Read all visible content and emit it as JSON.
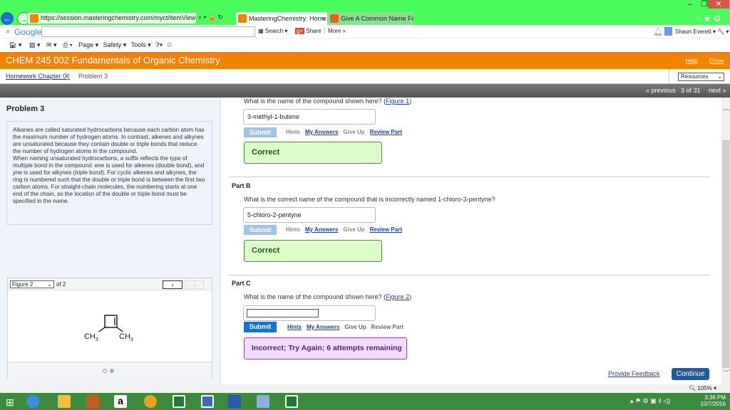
{
  "browser": {
    "url": "https://session.masteringchemistry.com/myct/itemView?assignn",
    "tabs": [
      {
        "label": "MasteringChemistry: Home...",
        "active": true
      },
      {
        "label": "Give A Common Name For Th...",
        "active": false
      }
    ],
    "google_toolbar": {
      "brand": "Google",
      "search_label": "Search",
      "share_label": "Share",
      "more_label": "More »",
      "user": "Shaun Everett"
    },
    "command_bar": {
      "page": "Page",
      "safety": "Safety",
      "tools": "Tools"
    },
    "zoom": "105%"
  },
  "header": {
    "title": "CHEM 245 002 Fundamentals of Organic Chemistry",
    "help": "Help",
    "close": "Close"
  },
  "breadcrumb": {
    "parent": "Homework Chapter 06",
    "current": "Problem 3",
    "resources": "Resources"
  },
  "pager": {
    "previous": "« previous",
    "position": "3 of 31",
    "next": "next »"
  },
  "problem": {
    "title": "Problem 3",
    "intro_p1": "Alkanes are called saturated hydrocarbons because each carbon atom has the maximum number of hydrogen atoms. In contrast, alkenes and alkynes are unsaturated because they contain double or triple bonds that reduce the number of hydrogen atoms in the compound.",
    "intro_p2a": "When naming unsaturated hydrocarbons, a suffix reflects the type of multiple bond in the compound: ",
    "ene": "ene",
    "intro_p2b": " is used for alkenes (double bond), and ",
    "yne": "yne",
    "intro_p2c": " is used for alkynes (triple bond). For cyclic alkenes and alkynes, the ring is numbered such that the double or triple bond is between the first two carbon atoms. For straight-chain molecules, the numbering starts at one end of the chain, so the location of the double or triple bond must be specified in the name."
  },
  "figure": {
    "selected": "Figure 2",
    "of": "of 2",
    "label_left": "CH",
    "label_right": "CH",
    "subscript": "3"
  },
  "parts": {
    "a": {
      "question": "What is the name of the compound shown here? (",
      "link": "Figure 1",
      "close": ")",
      "answer": "3-methyl-1-butene",
      "feedback": "Correct"
    },
    "b": {
      "label": "Part B",
      "question": "What is the correct name of the compound that is incorrectly named 1-chloro-3-pentyne?",
      "answer": "5-chloro-2-pentyne",
      "feedback": "Correct"
    },
    "c": {
      "label": "Part C",
      "question": "What is the name of the compound shown here? (",
      "link": "Figure 2",
      "close": ")",
      "answer": "",
      "feedback": "Incorrect; Try Again; 6 attempts remaining"
    }
  },
  "actions": {
    "submit": "Submit",
    "hints": "Hints",
    "my_answers": "My Answers",
    "give_up": "Give Up",
    "review_part": "Review Part"
  },
  "footer": {
    "feedback": "Provide Feedback",
    "continue": "Continue"
  },
  "taskbar": {
    "time": "3:36 PM",
    "date": "10/7/2016"
  },
  "colors": {
    "title_green": "#4cfc5c",
    "header_orange": "#f08300",
    "correct_bg": "#dcfcc8",
    "incorrect_bg": "#f2dcfc",
    "submit_active": "#1a73c8",
    "submit_disabled": "#a3c4e0"
  }
}
